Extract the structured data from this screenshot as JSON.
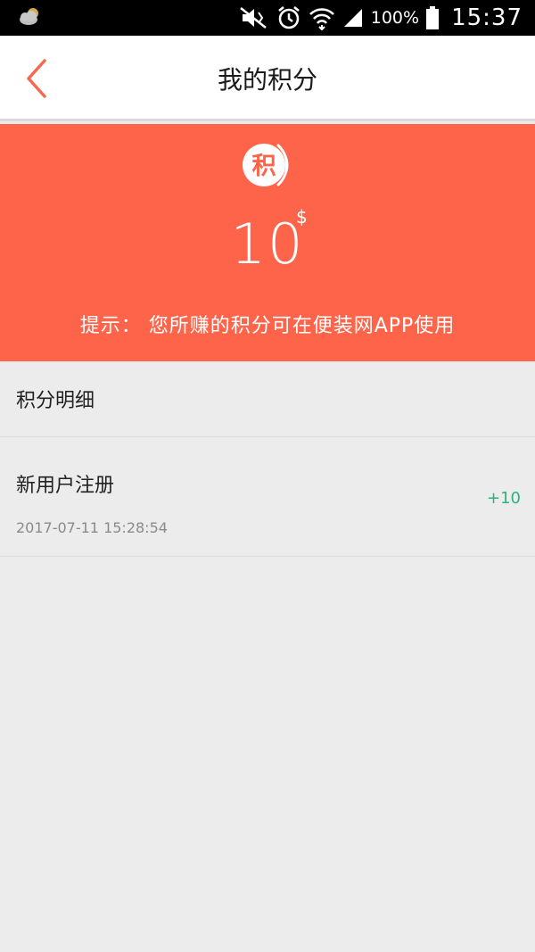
{
  "status_bar": {
    "battery": "100%",
    "time": "15:37",
    "icons": [
      "weather-icon",
      "mute-icon",
      "alarm-icon",
      "wifi-icon",
      "signal-icon",
      "battery-icon"
    ]
  },
  "nav": {
    "title": "我的积分",
    "back_icon": "chevron-left-icon"
  },
  "banner": {
    "badge_char": "积",
    "points": "10",
    "unit": "$",
    "tip": "提示： 您所赚的积分可在便装网APP使用",
    "color": "#fe6449"
  },
  "details": {
    "header": "积分明细",
    "records": [
      {
        "title": "新用户注册",
        "time": "2017-07-11 15:28:54",
        "points": "+10",
        "points_color": "#2bb47a"
      }
    ]
  }
}
